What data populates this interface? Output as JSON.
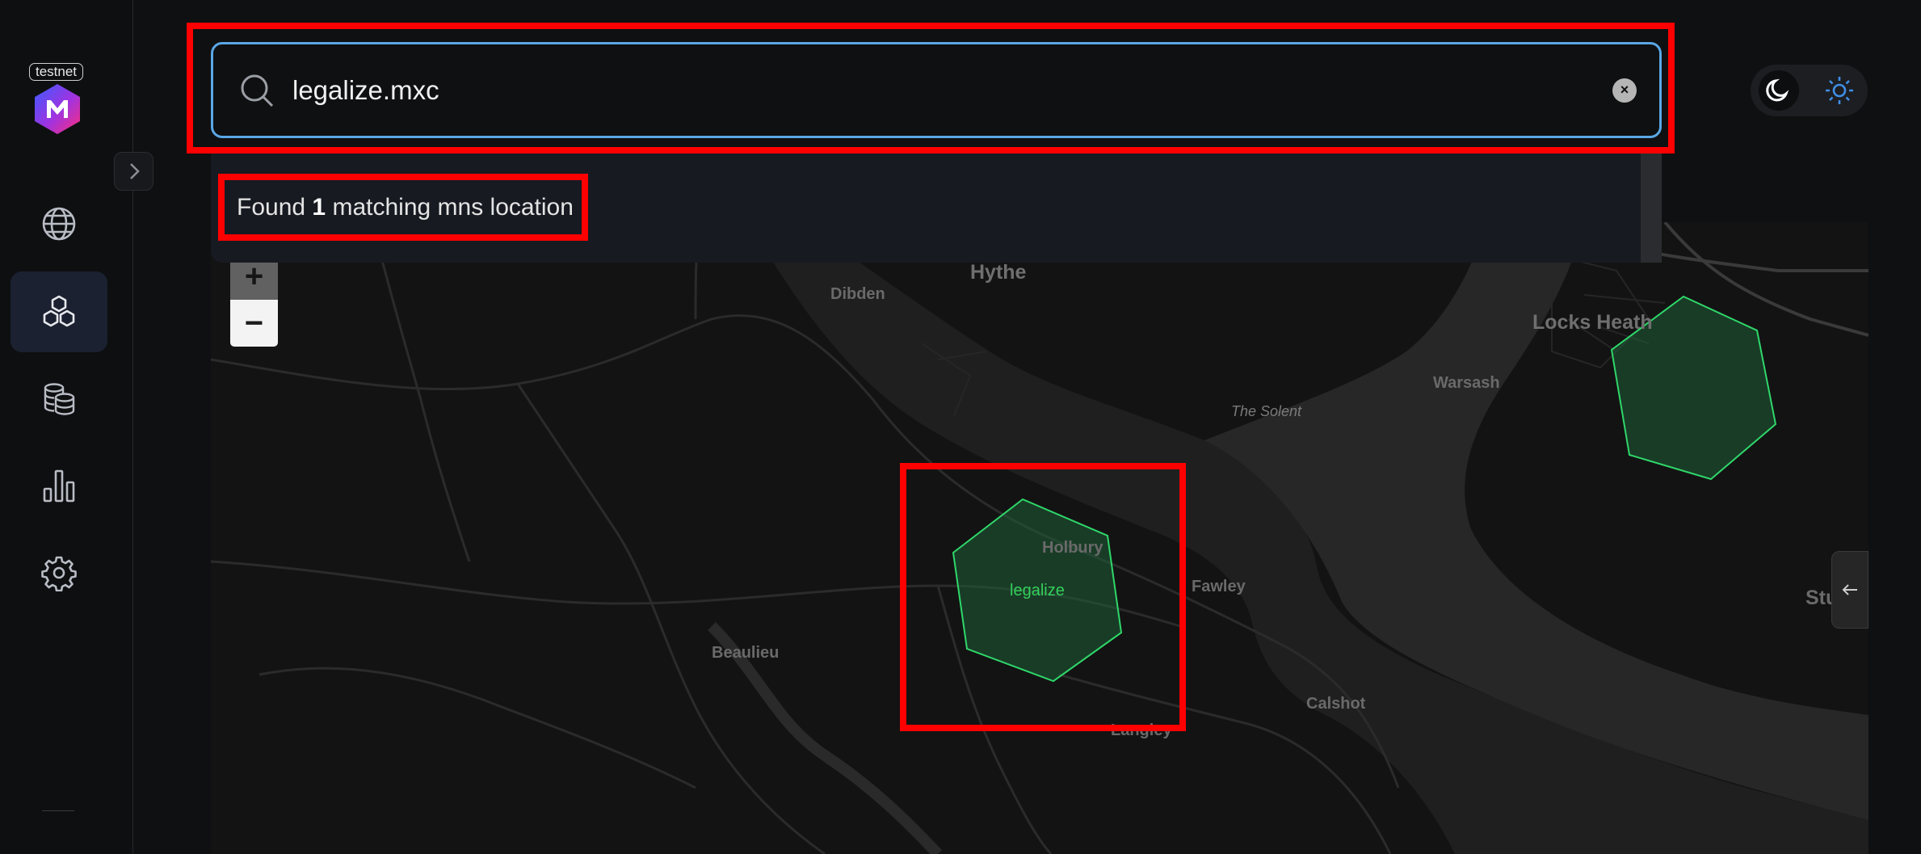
{
  "app": {
    "network_badge": "testnet"
  },
  "sidebar": {
    "items": [
      {
        "name": "globe",
        "icon": "globe-icon"
      },
      {
        "name": "hexagons",
        "icon": "hexagon-cluster-icon",
        "active": true
      },
      {
        "name": "coins",
        "icon": "coins-stack-icon"
      },
      {
        "name": "stats",
        "icon": "bar-chart-icon"
      },
      {
        "name": "settings",
        "icon": "gear-icon"
      }
    ]
  },
  "search": {
    "value": "legalize.mxc",
    "result_prefix": "Found",
    "result_count": "1",
    "result_suffix": "matching mns location"
  },
  "map": {
    "labels": [
      "Hythe",
      "Dibden",
      "Locks Heath",
      "Warsash",
      "The Solent",
      "Holbury",
      "Fawley",
      "Beaulieu",
      "Calshot",
      "Langley",
      "Stubb"
    ],
    "hex_label": "legalize",
    "zoom_in": "+",
    "zoom_out": "−",
    "hex_color": "#2fd76a"
  },
  "theme": {
    "modes": [
      "dark",
      "light"
    ],
    "selected": "dark"
  }
}
